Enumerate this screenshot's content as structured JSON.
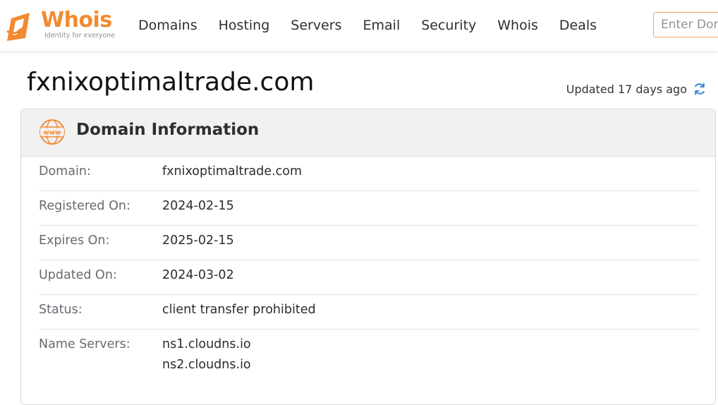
{
  "brand": {
    "name": "Whois",
    "tagline": "Identity for everyone",
    "accent_color": "#f28a30"
  },
  "nav": {
    "items": [
      "Domains",
      "Hosting",
      "Servers",
      "Email",
      "Security",
      "Whois",
      "Deals"
    ]
  },
  "search": {
    "placeholder": "Enter Domain"
  },
  "page": {
    "title": "fxnixoptimaltrade.com",
    "updated_text": "Updated 17 days ago",
    "refresh_icon": "refresh-icon"
  },
  "card": {
    "icon": "www-icon",
    "title": "Domain Information",
    "rows": [
      {
        "label": "Domain:",
        "values": [
          "fxnixoptimaltrade.com"
        ]
      },
      {
        "label": "Registered On:",
        "values": [
          "2024-02-15"
        ]
      },
      {
        "label": "Expires On:",
        "values": [
          "2025-02-15"
        ]
      },
      {
        "label": "Updated On:",
        "values": [
          "2024-03-02"
        ]
      },
      {
        "label": "Status:",
        "values": [
          "client transfer prohibited"
        ]
      },
      {
        "label": "Name Servers:",
        "values": [
          "ns1.cloudns.io",
          "ns2.cloudns.io"
        ]
      }
    ]
  }
}
